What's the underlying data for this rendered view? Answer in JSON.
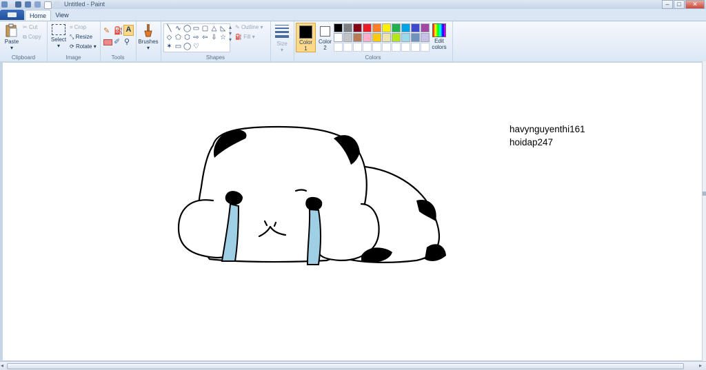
{
  "window": {
    "title": "Untitled - Paint",
    "min_label": "–",
    "max_label": "□",
    "close_label": "✕"
  },
  "tabs": {
    "home": "Home",
    "view": "View"
  },
  "clipboard": {
    "paste": "Paste",
    "cut": "Cut",
    "copy": "Copy",
    "group": "Clipboard"
  },
  "image": {
    "select": "Select",
    "crop": "Crop",
    "resize": "Resize",
    "rotate": "Rotate",
    "group": "Image"
  },
  "tools": {
    "group": "Tools"
  },
  "brushes": {
    "label": "Brushes"
  },
  "shapes": {
    "outline": "Outline",
    "fill": "Fill",
    "group": "Shapes",
    "icons": [
      "╲",
      "∿",
      "◯",
      "▭",
      "▢",
      "△",
      "◺",
      "◇",
      "⬠",
      "⬡",
      "⇨",
      "⇦",
      "⇩",
      "☆",
      "✶",
      "▭",
      "◯",
      "♡"
    ]
  },
  "size": {
    "label": "Size"
  },
  "colors": {
    "color1": "Color 1",
    "color2": "Color 2",
    "edit": "Edit colors",
    "group": "Colors",
    "color1_value": "#000000",
    "color2_value": "#ffffff",
    "row1": [
      "#000000",
      "#7f7f7f",
      "#880015",
      "#ed1c24",
      "#ff7f27",
      "#fff200",
      "#22b14c",
      "#00a2e8",
      "#3f48cc",
      "#a349a4"
    ],
    "row2": [
      "#ffffff",
      "#c3c3c3",
      "#b97a57",
      "#ffaec9",
      "#ffc90e",
      "#efe4b0",
      "#b5e61d",
      "#99d9ea",
      "#7092be",
      "#c8bfe7"
    ]
  },
  "canvas": {
    "line1": "havynguyenthi161",
    "line2": "hoidap247"
  }
}
